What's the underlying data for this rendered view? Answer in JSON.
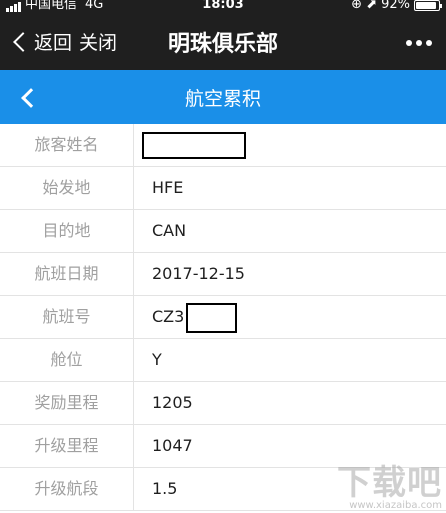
{
  "status_bar": {
    "carrier": "中国电信",
    "network": "4G",
    "time": "18:03",
    "icons": "⊕ ⬈",
    "battery": "92%",
    "battery_level": 0.92
  },
  "navbar": {
    "back_label": "返回",
    "close_label": "关闭",
    "title": "明珠俱乐部",
    "more_icon": "more-dots-icon"
  },
  "header": {
    "title": "航空累积",
    "back_icon": "chevron-left-icon",
    "color": "#1a8fe8"
  },
  "rows": [
    {
      "label": "旅客姓名",
      "value": ""
    },
    {
      "label": "始发地",
      "value": "HFE"
    },
    {
      "label": "目的地",
      "value": "CAN"
    },
    {
      "label": "航班日期",
      "value": "2017-12-15"
    },
    {
      "label": "航班号",
      "value": "CZ3"
    },
    {
      "label": "舱位",
      "value": "Y"
    },
    {
      "label": "奖励里程",
      "value": "1205"
    },
    {
      "label": "升级里程",
      "value": "1047"
    },
    {
      "label": "升级航段",
      "value": "1.5"
    }
  ],
  "watermark": {
    "big": "下载吧",
    "small": "www.xiazaiba.com"
  }
}
